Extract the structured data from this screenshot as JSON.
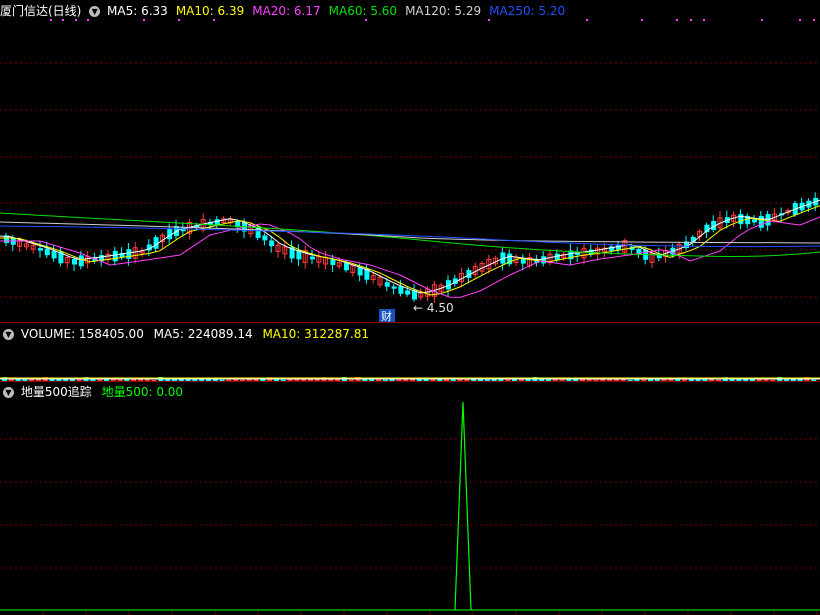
{
  "price_panel": {
    "stock_name": "厦门信达(日线)",
    "ma": [
      {
        "label": "MA5: 6.33",
        "color": "#ffffff"
      },
      {
        "label": "MA10: 6.39",
        "color": "#ffff00"
      },
      {
        "label": "MA20: 6.17",
        "color": "#ff40ff"
      },
      {
        "label": "MA60: 5.60",
        "color": "#00e000"
      },
      {
        "label": "MA120: 5.29",
        "color": "#d0d0d0"
      },
      {
        "label": "MA250: 5.20",
        "color": "#2050ff"
      }
    ],
    "low_marker": "4.50",
    "event_badge": "财"
  },
  "volume_panel": {
    "label": "VOLUME: 158405.00",
    "ma5": "MA5: 224089.14",
    "ma10": "MA10: 312287.81"
  },
  "indicator_panel": {
    "name": "地量500追踪",
    "value_label": "地量500: 0.00",
    "value_color": "#00ff00"
  },
  "colors": {
    "up": "#ff3b3b",
    "down": "#00ffff",
    "grid": "#7a0000",
    "signal": "#00ff00"
  }
}
